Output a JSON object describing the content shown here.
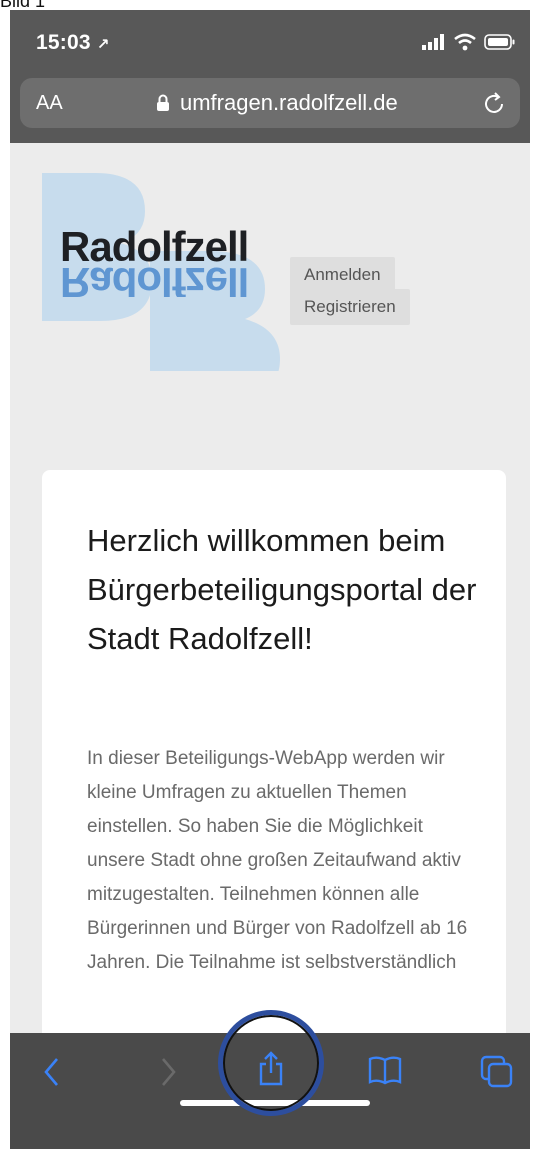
{
  "caption": "Bild 1",
  "status_bar": {
    "time": "15:03"
  },
  "url_bar": {
    "text_size_label": "AA",
    "url": "umfragen.radolfzell.de"
  },
  "site": {
    "logo": {
      "letters": "BB",
      "name": "Radolfzell",
      "mirrored": "Radolfzell"
    },
    "login_label": "Anmelden",
    "register_label": "Registrieren"
  },
  "card": {
    "heading": "Herzlich willkommen beim Bürgerbeteiligungsportal der Stadt Radolfzell!",
    "body": "In dieser Beteiligungs-WebApp werden wir kleine Umfragen zu aktuellen Themen einstellen. So haben Sie die Möglichkeit unsere Stadt ohne großen Zeitaufwand aktiv mitzugestalten. Teilnehmen können alle Bürgerinnen und Bürger von Radolfzell ab 16 Jahren. Die Teilnahme ist selbstverständlich"
  },
  "toolbar": {
    "items": [
      "back-icon",
      "forward-icon",
      "share-icon",
      "bookmarks-icon",
      "tabs-icon"
    ],
    "accent_color": "#3a82f7"
  },
  "colors": {
    "annotation_circle": "#2d4e9e",
    "logo_bb": "#c7dced"
  }
}
